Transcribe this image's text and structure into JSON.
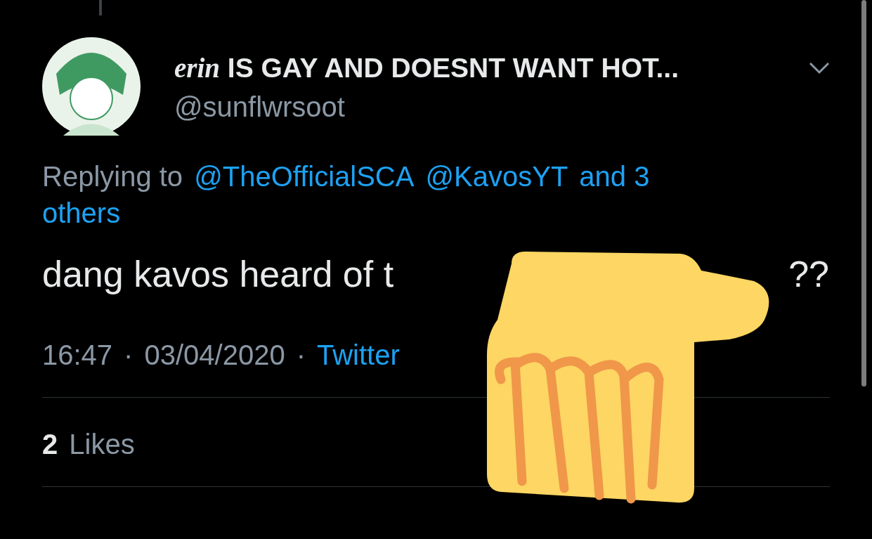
{
  "author": {
    "name_prefix": "erin",
    "display_name": "IS GAY AND DOESNT WANT HOT...",
    "handle": "@sunflwrsoot"
  },
  "reply_context": {
    "label": "Replying to",
    "mentions": [
      "@TheOfficialSCA",
      "@KavosYT"
    ],
    "others_lines": [
      "and 3",
      "others"
    ]
  },
  "tweet_text": [
    "dang kavos heard of t",
    "??"
  ],
  "meta": {
    "time": "16:47",
    "separator": "·",
    "date": "03/04/2020",
    "source": "Twitter"
  },
  "likes": {
    "count": "2",
    "label": "Likes"
  },
  "overlay": {
    "kind": "pointing-hand"
  }
}
